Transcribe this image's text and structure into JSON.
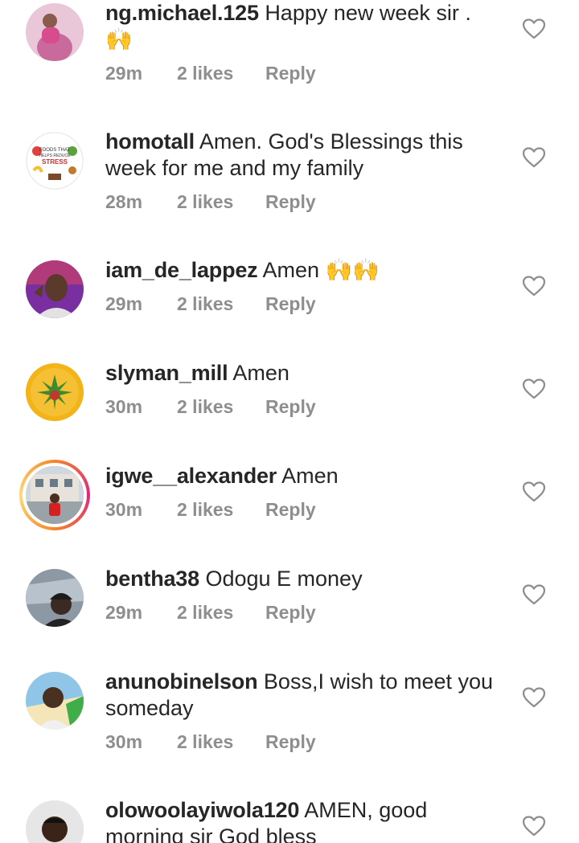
{
  "comments": [
    {
      "username": "ng.michael.125",
      "text": "Happy new week sir .",
      "emoji": "🙌",
      "time": "29m",
      "likes": "2 likes",
      "reply": "Reply",
      "avatar": "pink-photo"
    },
    {
      "username": "homotall",
      "text": "Amen. God's Blessings this week for me and my family",
      "time": "28m",
      "likes": "2 likes",
      "reply": "Reply",
      "avatar": "foods-that-helps-reduce-stress",
      "avatar_text": {
        "line1": "FOODS THAT",
        "line2": "HELPS REDUCE",
        "line3": "STRESS"
      }
    },
    {
      "username": "iam_de_lappez",
      "text": "Amen",
      "emoji": "🙌🙌",
      "time": "29m",
      "likes": "2 likes",
      "reply": "Reply",
      "avatar": "man-purple-background"
    },
    {
      "username": "slyman_mill",
      "text": "Amen",
      "time": "30m",
      "likes": "2 likes",
      "reply": "Reply",
      "avatar": "yellow-leaf-logo"
    },
    {
      "username": "igwe__alexander",
      "text": "Amen",
      "time": "30m",
      "likes": "2 likes",
      "reply": "Reply",
      "avatar": "man-in-front-of-building",
      "has_story_ring": true
    },
    {
      "username": "bentha38",
      "text": "Odogu E money",
      "time": "29m",
      "likes": "2 likes",
      "reply": "Reply",
      "avatar": "man-with-cap"
    },
    {
      "username": "anunobinelson",
      "text": "Boss,I wish to meet you someday",
      "time": "30m",
      "likes": "2 likes",
      "reply": "Reply",
      "avatar": "man-smiling"
    },
    {
      "username": "olowoolayiwola120",
      "text": "AMEN, good morning sir God bless",
      "avatar": "man-portrait"
    }
  ]
}
